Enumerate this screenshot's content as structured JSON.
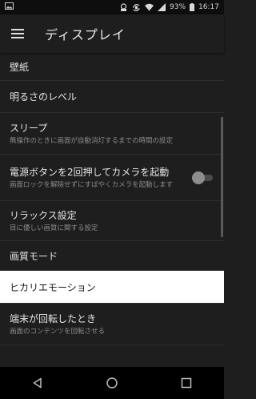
{
  "status_bar": {
    "battery_text": "93%",
    "time": "16:17",
    "icons": [
      "image-icon",
      "notification-icon",
      "rotate-icon",
      "wifi-icon",
      "cell-signal-icon",
      "battery-icon"
    ]
  },
  "app_bar": {
    "title": "ディスプレイ",
    "menu_icon": "hamburger-menu-icon"
  },
  "settings": [
    {
      "title": "壁紙",
      "subtitle": ""
    },
    {
      "title": "明るさのレベル",
      "subtitle": ""
    },
    {
      "title": "スリープ",
      "subtitle": "無操作のときに画面が自動消灯するまでの時間の設定"
    },
    {
      "title": "電源ボタンを2回押してカメラを起動",
      "subtitle": "画面ロックを解除せずにすばやくカメラを起動します",
      "toggle": false
    },
    {
      "title": "リラックス設定",
      "subtitle": "目に優しい画質に関する設定"
    },
    {
      "title": "画質モード",
      "subtitle": ""
    },
    {
      "title": "ヒカリエモーション",
      "subtitle": "",
      "highlighted": true
    },
    {
      "title": "端末が回転したとき",
      "subtitle": "画面のコンテンツを回転させる"
    }
  ],
  "nav_bar": {
    "icons": [
      "back-icon",
      "home-icon",
      "recents-icon"
    ]
  },
  "colors": {
    "background": "#1e1e1e",
    "highlight": "#ffffff",
    "status_bar": "#0e0e0e",
    "nav_bar": "#000000"
  }
}
